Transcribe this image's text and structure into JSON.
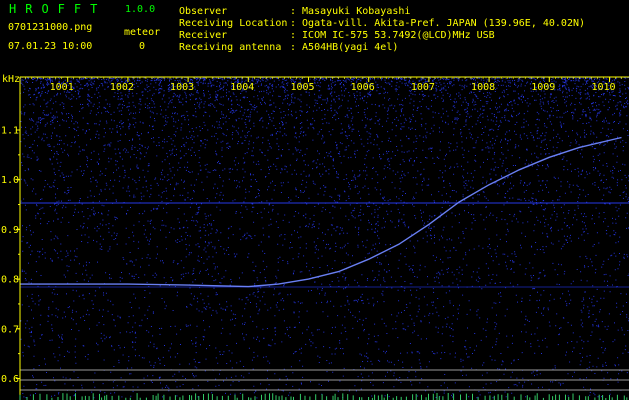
{
  "app": {
    "title": "HROFFT",
    "version": "1.0.0"
  },
  "file": {
    "name": "0701231000.png",
    "datetime": "07.01.23 10:00"
  },
  "meteor": {
    "label": "meteor",
    "count": "0"
  },
  "info": {
    "observer_label": "Observer",
    "observer_value": ": Masayuki Kobayashi",
    "location_label": "Receiving Location",
    "location_value": ": Ogata-vill. Akita-Pref. JAPAN (139.96E, 40.02N)",
    "receiver_label": "Receiver",
    "receiver_value": ": ICOM IC-575 53.7492(@LCD)MHz USB",
    "antenna_label": "Receiving antenna",
    "antenna_value": ": A504HB(yagi 4el)"
  },
  "colors": {
    "accent": "#ffff00",
    "title": "#00ff00",
    "noise": "#2a3cff",
    "background": "#000000"
  },
  "chart_data": {
    "type": "heatmap",
    "ylabel": "kHz",
    "y_ticks": [
      "1.1",
      "1.0",
      "0.9",
      "0.8",
      "0.7",
      "0.6"
    ],
    "x_ticks": [
      "1001",
      "1002",
      "1003",
      "1004",
      "1005",
      "1006",
      "1007",
      "1008",
      "1009",
      "1010"
    ],
    "trace": {
      "x": [
        1000.2,
        1001,
        1002,
        1003,
        1004,
        1004.5,
        1005,
        1005.5,
        1006,
        1006.5,
        1007,
        1007.5,
        1008,
        1008.5,
        1009,
        1009.5,
        1010.2
      ],
      "y": [
        0.79,
        0.79,
        0.79,
        0.788,
        0.785,
        0.79,
        0.8,
        0.815,
        0.84,
        0.87,
        0.91,
        0.955,
        0.99,
        1.02,
        1.045,
        1.065,
        1.085
      ]
    }
  }
}
